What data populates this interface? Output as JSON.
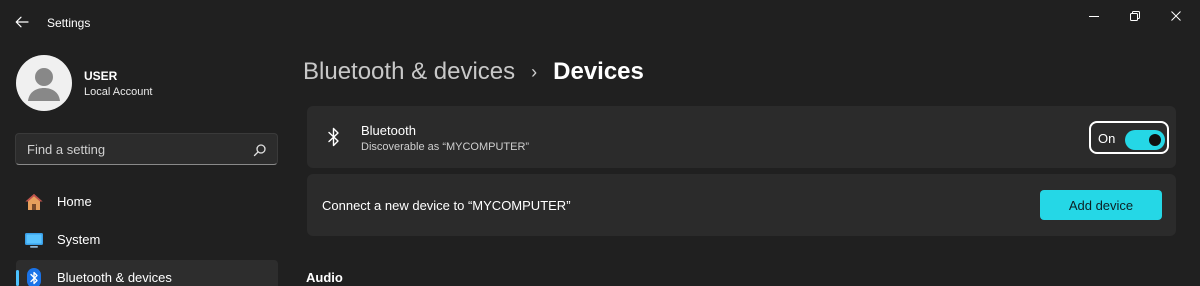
{
  "titlebar": {
    "app_title": "Settings",
    "back_icon": "back-arrow-icon",
    "controls": [
      "minimize-icon",
      "restore-icon",
      "close-icon"
    ]
  },
  "profile": {
    "name": "USER",
    "account_type": "Local Account"
  },
  "search": {
    "placeholder": "Find a setting",
    "icon": "search-icon"
  },
  "sidebar": {
    "items": [
      {
        "label": "Home",
        "icon": "home-icon",
        "active": false
      },
      {
        "label": "System",
        "icon": "system-icon",
        "active": false
      },
      {
        "label": "Bluetooth & devices",
        "icon": "bluetooth-icon",
        "active": true
      }
    ]
  },
  "breadcrumb": {
    "parent": "Bluetooth & devices",
    "separator": "›",
    "current": "Devices"
  },
  "bluetooth_card": {
    "title": "Bluetooth",
    "subtitle": "Discoverable as “MYCOMPUTER”",
    "toggle_label": "On",
    "toggle_state": true
  },
  "connect_card": {
    "text": "Connect a new device to “MYCOMPUTER”",
    "button_label": "Add device"
  },
  "sections": {
    "audio": "Audio"
  },
  "colors": {
    "background": "#202020",
    "card": "#2b2b2b",
    "accent": "#25d7e6",
    "active_indicator": "#4cc2ff"
  }
}
